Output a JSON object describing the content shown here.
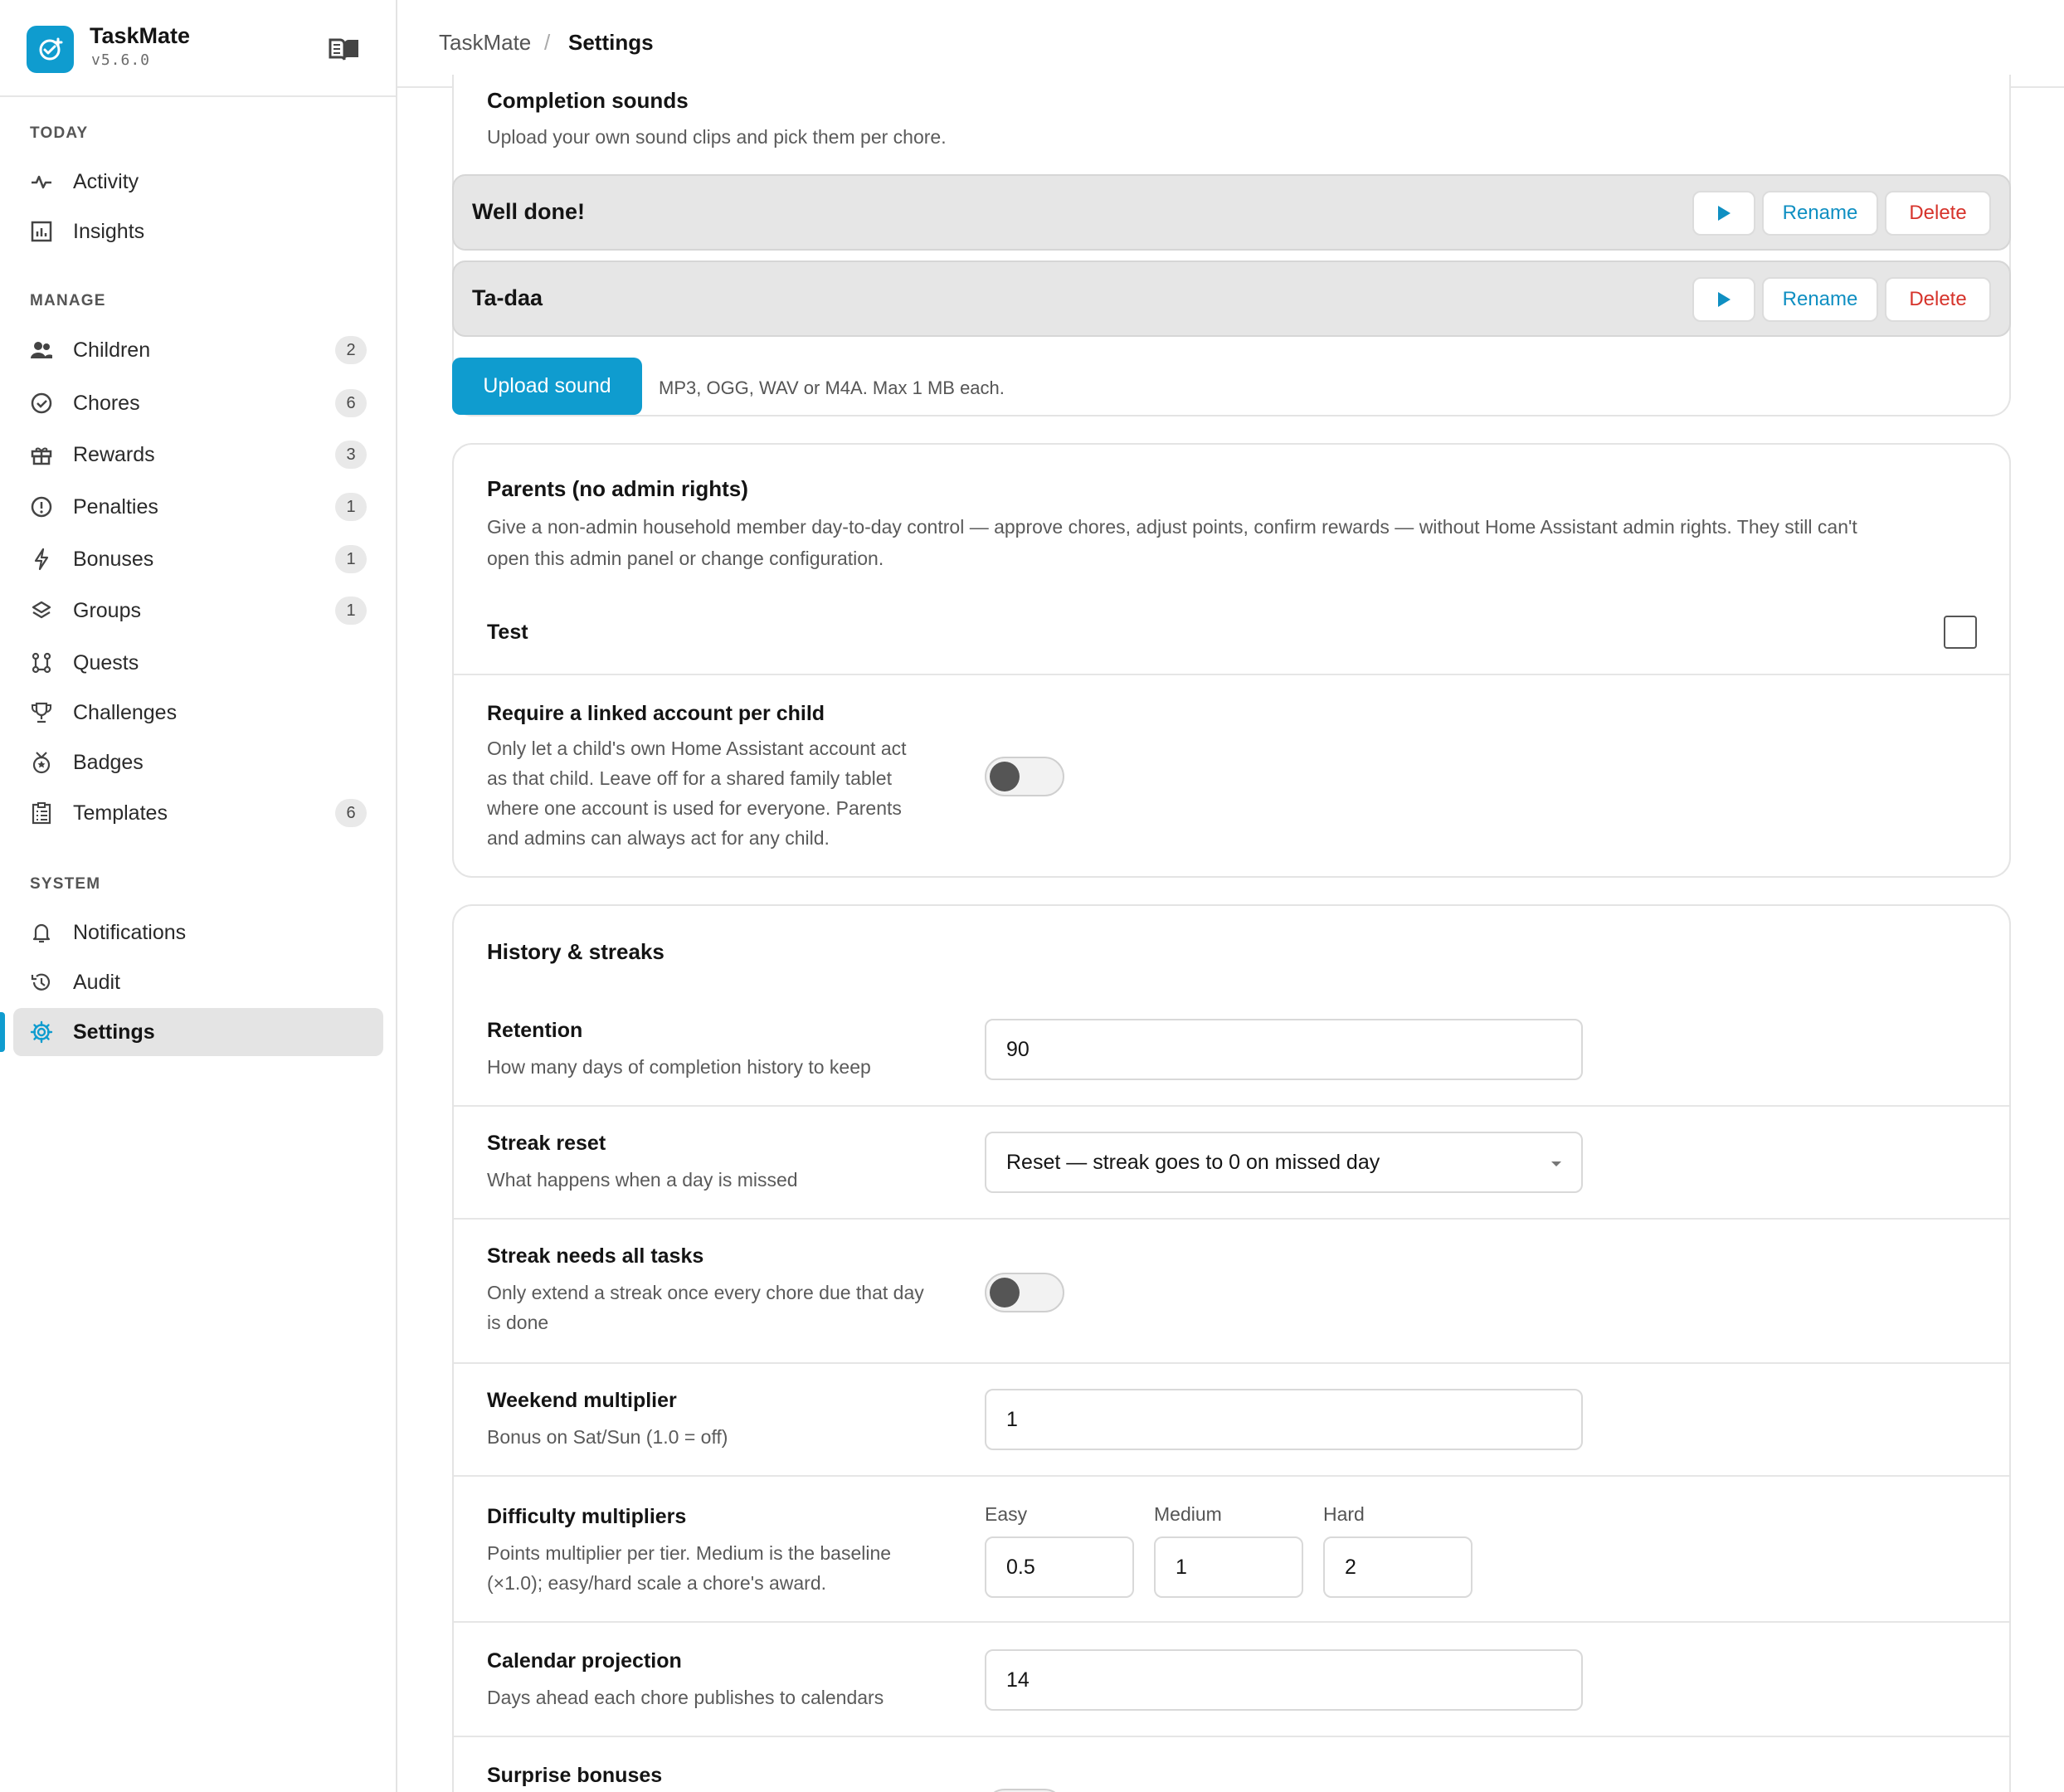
{
  "app": {
    "name": "TaskMate",
    "version": "v5.6.0"
  },
  "sidebar": {
    "sections": {
      "today": "TODAY",
      "manage": "MANAGE",
      "system": "SYSTEM"
    },
    "today": [
      {
        "label": "Activity",
        "icon": "activity-icon"
      },
      {
        "label": "Insights",
        "icon": "insights-icon"
      }
    ],
    "manage": [
      {
        "label": "Children",
        "count": "2",
        "icon": "people-icon"
      },
      {
        "label": "Chores",
        "count": "6",
        "icon": "check-circle-icon"
      },
      {
        "label": "Rewards",
        "count": "3",
        "icon": "gift-icon"
      },
      {
        "label": "Penalties",
        "count": "1",
        "icon": "alert-circle-icon"
      },
      {
        "label": "Bonuses",
        "count": "1",
        "icon": "bolt-icon"
      },
      {
        "label": "Groups",
        "count": "1",
        "icon": "layers-icon"
      },
      {
        "label": "Quests",
        "icon": "quest-icon"
      },
      {
        "label": "Challenges",
        "icon": "trophy-icon"
      },
      {
        "label": "Badges",
        "icon": "badge-icon"
      },
      {
        "label": "Templates",
        "count": "6",
        "icon": "clipboard-icon"
      }
    ],
    "system": [
      {
        "label": "Notifications",
        "icon": "bell-icon"
      },
      {
        "label": "Audit",
        "icon": "history-icon"
      },
      {
        "label": "Settings",
        "icon": "gear-icon",
        "active": true
      }
    ]
  },
  "header": {
    "breadcrumb_root": "TaskMate",
    "separator": "/",
    "current": "Settings"
  },
  "completion_sounds": {
    "title": "Completion sounds",
    "description": "Upload your own sound clips and pick them per chore.",
    "sounds": [
      {
        "name": "Well done!"
      },
      {
        "name": "Ta-daa"
      }
    ],
    "rename_label": "Rename",
    "delete_label": "Delete",
    "upload_label": "Upload sound",
    "upload_hint": "MP3, OGG, WAV or M4A. Max 1 MB each."
  },
  "parents": {
    "title": "Parents (no admin rights)",
    "description_line1": "Give a non-admin household member day-to-day control — approve chores, adjust points, confirm rewards — without Home Assistant admin rights. They still can't",
    "description_line2": "open this admin panel or change configuration.",
    "users": [
      {
        "name": "Test",
        "checked": false
      }
    ],
    "linked_account": {
      "title": "Require a linked account per child",
      "desc_lines": [
        "Only let a child's own Home Assistant account act",
        "as that child. Leave off for a shared family tablet",
        "where one account is used for everyone. Parents",
        "and admins can always act for any child."
      ],
      "enabled": false
    }
  },
  "history": {
    "title": "History & streaks",
    "retention": {
      "title": "Retention",
      "desc": "How many days of completion history to keep",
      "value": "90"
    },
    "streak_reset": {
      "title": "Streak reset",
      "desc": "What happens when a day is missed",
      "value": "Reset — streak goes to 0 on missed day"
    },
    "streak_all": {
      "title": "Streak needs all tasks",
      "desc_lines": [
        "Only extend a streak once every chore due that day",
        "is done"
      ],
      "enabled": false
    },
    "weekend": {
      "title": "Weekend multiplier",
      "desc": "Bonus on Sat/Sun (1.0 = off)",
      "value": "1"
    },
    "difficulty": {
      "title": "Difficulty multipliers",
      "desc_lines": [
        "Points multiplier per tier. Medium is the baseline",
        "(×1.0); easy/hard scale a chore's award."
      ],
      "easy_label": "Easy",
      "easy": "0.5",
      "medium_label": "Medium",
      "medium": "1",
      "hard_label": "Hard",
      "hard": "2"
    },
    "calendar": {
      "title": "Calendar projection",
      "desc": "Days ahead each chore publishes to calendars",
      "value": "14"
    },
    "surprise": {
      "title": "Surprise bonuses"
    }
  },
  "colors": {
    "accent": "#0f9ccf",
    "danger": "#d6332b"
  }
}
